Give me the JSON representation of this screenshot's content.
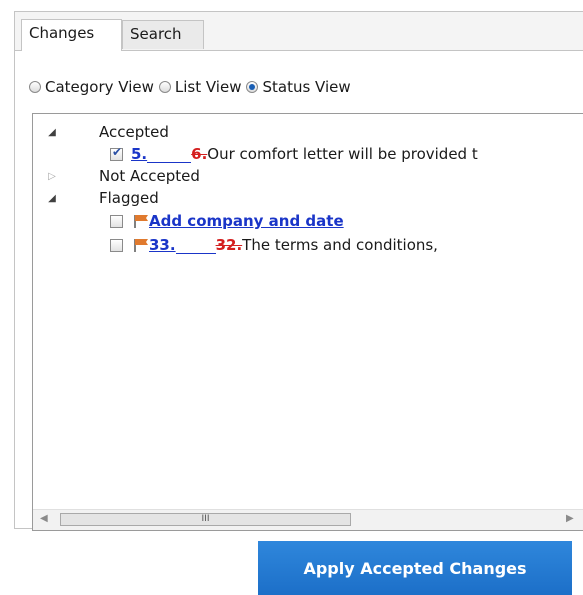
{
  "tabs": [
    {
      "label": "Changes",
      "active": true
    },
    {
      "label": "Search",
      "active": false
    }
  ],
  "view_options": [
    {
      "label": "Category View",
      "selected": false
    },
    {
      "label": "List View",
      "selected": false
    },
    {
      "label": "Status View",
      "selected": true
    }
  ],
  "groups": {
    "accepted": {
      "label": "Accepted",
      "expanded": true,
      "items": [
        {
          "checked": true,
          "flagged": false,
          "new_number": "5.",
          "old_number": "6.",
          "text": "Our comfort letter will be provided t"
        }
      ]
    },
    "not_accepted": {
      "label": "Not Accepted",
      "expanded": false
    },
    "flagged": {
      "label": "Flagged",
      "expanded": true,
      "items": [
        {
          "checked": false,
          "flagged": true,
          "text": "Add company and date"
        },
        {
          "checked": false,
          "flagged": true,
          "new_number": "33.",
          "old_number": "32.",
          "text": "The terms and conditions,"
        }
      ]
    }
  },
  "scrollbar": {
    "thumb_grip": "III"
  },
  "apply_button": {
    "label": "Apply Accepted Changes"
  },
  "colors": {
    "insertion": "#1a35c8",
    "deletion": "#d41f1f",
    "flag": "#e07a2e",
    "button": "#1c6fc8"
  },
  "icons": [
    "expanded-icon",
    "collapsed-icon",
    "flag-icon",
    "scroll-left-icon",
    "scroll-right-icon"
  ]
}
